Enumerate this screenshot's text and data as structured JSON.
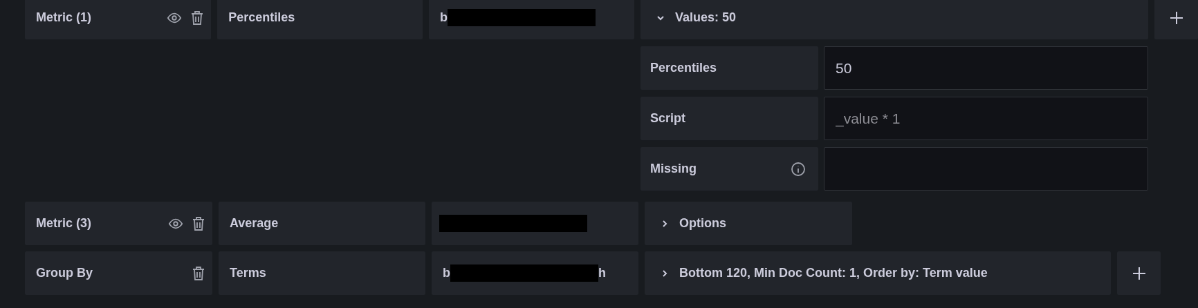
{
  "rows": [
    {
      "kind": "metric",
      "label": "Metric (1)",
      "type": "Percentiles",
      "field": {
        "texts": [
          "b"
        ],
        "redacted": true
      },
      "options": {
        "expanded": true,
        "summary": "Values: 50",
        "settings": [
          {
            "label": "Percentiles",
            "value": "50"
          },
          {
            "label": "Script",
            "placeholder": "_value * 1"
          },
          {
            "label": "Missing",
            "info": true
          }
        ]
      },
      "add_button": true
    },
    {
      "kind": "metric",
      "label": "Metric (3)",
      "type": "Average",
      "field": {
        "redacted": true
      },
      "options": {
        "expanded": false,
        "summary": "Options"
      }
    },
    {
      "kind": "group_by",
      "label": "Group By",
      "type": "Terms",
      "field": {
        "texts": [
          "b",
          "h"
        ],
        "redacted": true
      },
      "options": {
        "expanded": false,
        "summary": "Bottom 120, Min Doc Count: 1, Order by: Term value"
      },
      "add_button": true
    }
  ]
}
